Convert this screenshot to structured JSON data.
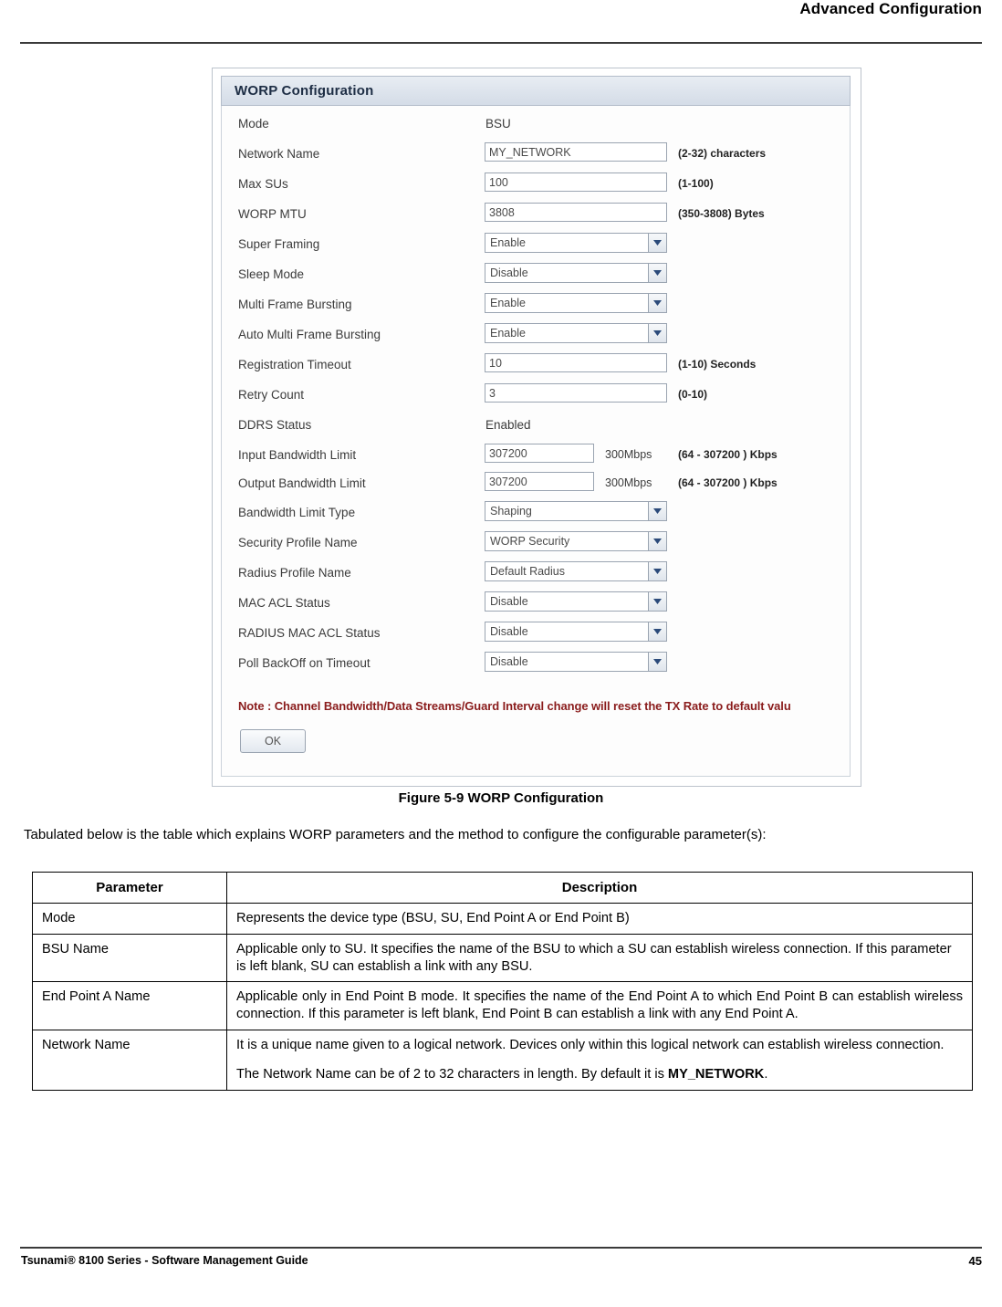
{
  "header": {
    "title": "Advanced Configuration"
  },
  "figure": {
    "panel_title": "WORP Configuration",
    "rows": [
      {
        "label": "Mode",
        "type": "static",
        "value": "BSU",
        "hint": ""
      },
      {
        "label": "Network Name",
        "type": "input",
        "value": "MY_NETWORK",
        "hint": "(2-32) characters"
      },
      {
        "label": "Max SUs",
        "type": "input",
        "value": "100",
        "hint": "(1-100)"
      },
      {
        "label": "WORP MTU",
        "type": "input",
        "value": "3808",
        "hint": "(350-3808) Bytes"
      },
      {
        "label": "Super Framing",
        "type": "select",
        "value": "Enable",
        "hint": ""
      },
      {
        "label": "Sleep Mode",
        "type": "select",
        "value": "Disable",
        "hint": ""
      },
      {
        "label": "Multi Frame Bursting",
        "type": "select",
        "value": "Enable",
        "hint": ""
      },
      {
        "label": "Auto Multi Frame Bursting",
        "type": "select",
        "value": "Enable",
        "hint": ""
      },
      {
        "label": "Registration Timeout",
        "type": "input",
        "value": "10",
        "hint": "(1-10) Seconds"
      },
      {
        "label": "Retry Count",
        "type": "input",
        "value": "3",
        "hint": "(0-10)"
      },
      {
        "label": "DDRS Status",
        "type": "static",
        "value": "Enabled",
        "hint": ""
      },
      {
        "label": "Input Bandwidth Limit",
        "type": "input-short",
        "value": "307200",
        "mid": "300Mbps",
        "hint": "(64 - 307200 ) Kbps"
      },
      {
        "label": "Output Bandwidth Limit",
        "type": "input-short",
        "value": "307200",
        "mid": "300Mbps",
        "hint": "(64 - 307200 ) Kbps"
      },
      {
        "label": "Bandwidth Limit Type",
        "type": "select",
        "value": "Shaping",
        "hint": ""
      },
      {
        "label": "Security Profile Name",
        "type": "select",
        "value": "WORP Security",
        "hint": ""
      },
      {
        "label": "Radius Profile Name",
        "type": "select",
        "value": "Default Radius",
        "hint": ""
      },
      {
        "label": "MAC ACL Status",
        "type": "select",
        "value": "Disable",
        "hint": ""
      },
      {
        "label": "RADIUS MAC ACL Status",
        "type": "select",
        "value": "Disable",
        "hint": ""
      },
      {
        "label": "Poll BackOff on Timeout",
        "type": "select",
        "value": "Disable",
        "hint": ""
      }
    ],
    "note": "Note : Channel Bandwidth/Data Streams/Guard Interval change will reset the TX Rate to default valu",
    "ok_label": "OK",
    "caption": "Figure 5-9 WORP Configuration"
  },
  "intro": "Tabulated below is the table which explains WORP parameters and the method to configure the configurable parameter(s):",
  "table": {
    "headers": [
      "Parameter",
      "Description"
    ],
    "rows": [
      {
        "parameter": "Mode",
        "description": [
          "Represents the device type (BSU, SU, End Point A or End Point B)"
        ]
      },
      {
        "parameter": "BSU Name",
        "description": [
          "Applicable only to SU. It specifies the name of the BSU to which a SU can establish wireless connection. If this parameter is left blank, SU can establish a link with any BSU."
        ]
      },
      {
        "parameter": "End Point A Name",
        "description": [
          "Applicable only in End Point B mode. It specifies the name of the End Point A to which End Point B can establish wireless connection. If this parameter is left blank, End Point B can establish a link with any End Point A."
        ]
      },
      {
        "parameter": "Network Name",
        "description": [
          "It is a unique name given to a logical network. Devices only within this logical network can establish wireless connection."
        ],
        "description2_pre": "The Network Name can be of 2 to 32 characters in length. By default it is ",
        "description2_bold": "MY_NETWORK",
        "description2_post": "."
      }
    ]
  },
  "footer": {
    "left": "Tsunami® 8100 Series - Software Management Guide",
    "right": "45"
  }
}
